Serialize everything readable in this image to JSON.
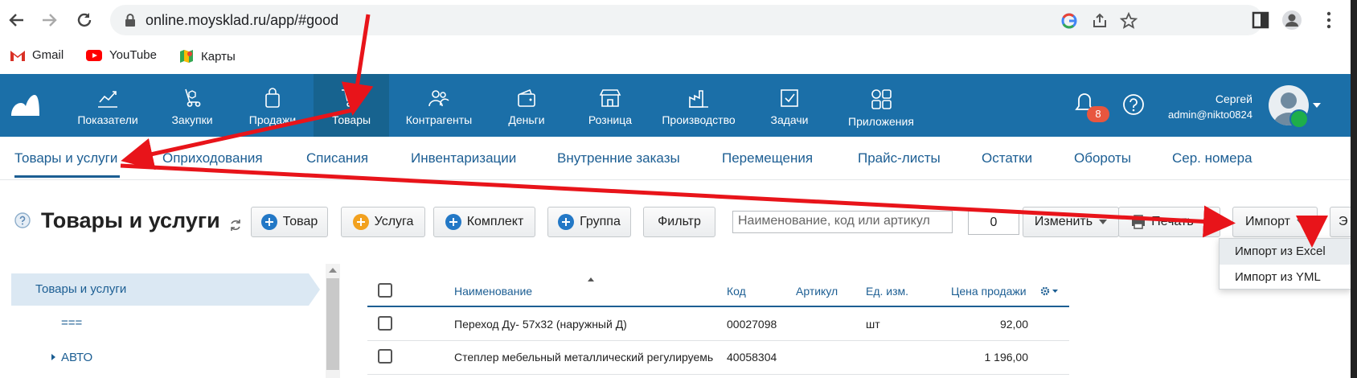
{
  "browser": {
    "url": "online.moysklad.ru/app/#good",
    "bookmarks": [
      {
        "label": "Gmail",
        "icon": "gmail-icon"
      },
      {
        "label": "YouTube",
        "icon": "youtube-icon"
      },
      {
        "label": "Карты",
        "icon": "maps-icon"
      }
    ]
  },
  "header": {
    "nav": [
      {
        "label": "Показатели",
        "icon": "chart-icon"
      },
      {
        "label": "Закупки",
        "icon": "purchase-icon"
      },
      {
        "label": "Продажи",
        "icon": "bag-icon"
      },
      {
        "label": "Товары",
        "icon": "cart-icon",
        "active": true
      },
      {
        "label": "Контрагенты",
        "icon": "people-icon"
      },
      {
        "label": "Деньги",
        "icon": "wallet-icon"
      },
      {
        "label": "Розница",
        "icon": "store-icon"
      },
      {
        "label": "Производство",
        "icon": "factory-icon"
      },
      {
        "label": "Задачи",
        "icon": "tasks-icon"
      },
      {
        "label": "Приложения",
        "icon": "apps-icon"
      }
    ],
    "notifications_count": "8",
    "user_name": "Сергей",
    "user_email": "admin@nikto0824"
  },
  "subtabs": [
    "Товары и услуги",
    "Оприходования",
    "Списания",
    "Инвентаризации",
    "Внутренние заказы",
    "Перемещения",
    "Прайс-листы",
    "Остатки",
    "Обороты",
    "Сер. номера"
  ],
  "toolbar": {
    "page_title": "Товары и услуги",
    "btn_product": "Товар",
    "btn_service": "Услуга",
    "btn_kit": "Комплект",
    "btn_group": "Группа",
    "btn_filter": "Фильтр",
    "search_placeholder": "Наименование, код или артикул",
    "counter": "0",
    "btn_edit": "Изменить",
    "btn_print": "Печать",
    "btn_import": "Импорт",
    "btn_export_partial": "Э"
  },
  "import_menu": [
    "Импорт из Excel",
    "Импорт из YML"
  ],
  "tree": {
    "root": "Товары и услуги",
    "items": [
      "===",
      "АВТО"
    ]
  },
  "table": {
    "columns": [
      "Наименование",
      "Код",
      "Артикул",
      "Ед. изм.",
      "Цена продажи"
    ],
    "rows": [
      {
        "name": "Переход Ду- 57х32 (наружный Д)",
        "code": "00027098",
        "article": "",
        "unit": "шт",
        "price": "92,00"
      },
      {
        "name": "Степлер мебельный металлический регулируемь",
        "code": "40058304",
        "article": "",
        "unit": "",
        "price": "1 196,00"
      }
    ]
  },
  "colors": {
    "header_bg": "#1b6fa8",
    "link": "#1c5e93",
    "annotation_arrow": "#e8141a"
  }
}
